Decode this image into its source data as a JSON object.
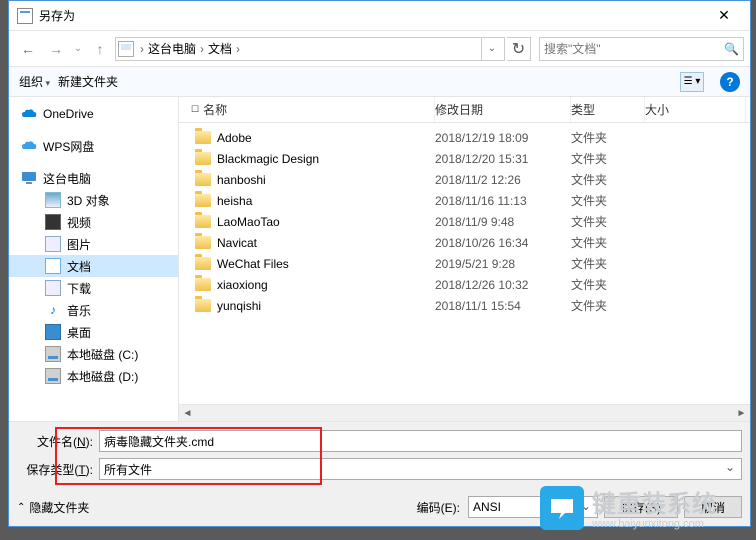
{
  "window": {
    "title": "另存为"
  },
  "path": {
    "crumb1": "这台电脑",
    "crumb2": "文档"
  },
  "search": {
    "placeholder": "搜索\"文档\""
  },
  "toolbar": {
    "organize": "组织",
    "newFolder": "新建文件夹"
  },
  "headers": {
    "name": "名称",
    "date": "修改日期",
    "type": "类型",
    "size": "大小"
  },
  "sidebar": {
    "onedrive": "OneDrive",
    "wps": "WPS网盘",
    "pc": "这台电脑",
    "d3": "3D 对象",
    "video": "视频",
    "images": "图片",
    "docs": "文档",
    "downloads": "下载",
    "music": "音乐",
    "desktop": "桌面",
    "diskC": "本地磁盘 (C:)",
    "diskD": "本地磁盘 (D:)"
  },
  "files": [
    {
      "name": "Adobe",
      "date": "2018/12/19 18:09",
      "type": "文件夹"
    },
    {
      "name": "Blackmagic Design",
      "date": "2018/12/20 15:31",
      "type": "文件夹"
    },
    {
      "name": "hanboshi",
      "date": "2018/11/2 12:26",
      "type": "文件夹"
    },
    {
      "name": "heisha",
      "date": "2018/11/16 11:13",
      "type": "文件夹"
    },
    {
      "name": "LaoMaoTao",
      "date": "2018/11/9 9:48",
      "type": "文件夹"
    },
    {
      "name": "Navicat",
      "date": "2018/10/26 16:34",
      "type": "文件夹"
    },
    {
      "name": "WeChat Files",
      "date": "2019/5/21 9:28",
      "type": "文件夹"
    },
    {
      "name": "xiaoxiong",
      "date": "2018/12/26 10:32",
      "type": "文件夹"
    },
    {
      "name": "yunqishi",
      "date": "2018/11/1 15:54",
      "type": "文件夹"
    }
  ],
  "form": {
    "filenameLabelPre": "文件名(",
    "filenameKey": "N",
    "filenameLabelPost": "):",
    "filename": "病毒隐藏文件夹.cmd",
    "filetypeLabelPre": "保存类型(",
    "filetypeKey": "T",
    "filetypeLabelPost": "):",
    "filetype": "所有文件"
  },
  "footer": {
    "hideFolders": "隐藏文件夹",
    "encodingLabelPre": "编码(",
    "encodingKey": "E",
    "encodingLabelPost": "):",
    "encoding": "ANSI",
    "savePre": "保存(",
    "saveKey": "S",
    "savePost": ")",
    "cancel": "取消"
  },
  "overlay": {
    "brand": "键重装系统",
    "url": "www.baiyunxitong.com"
  }
}
